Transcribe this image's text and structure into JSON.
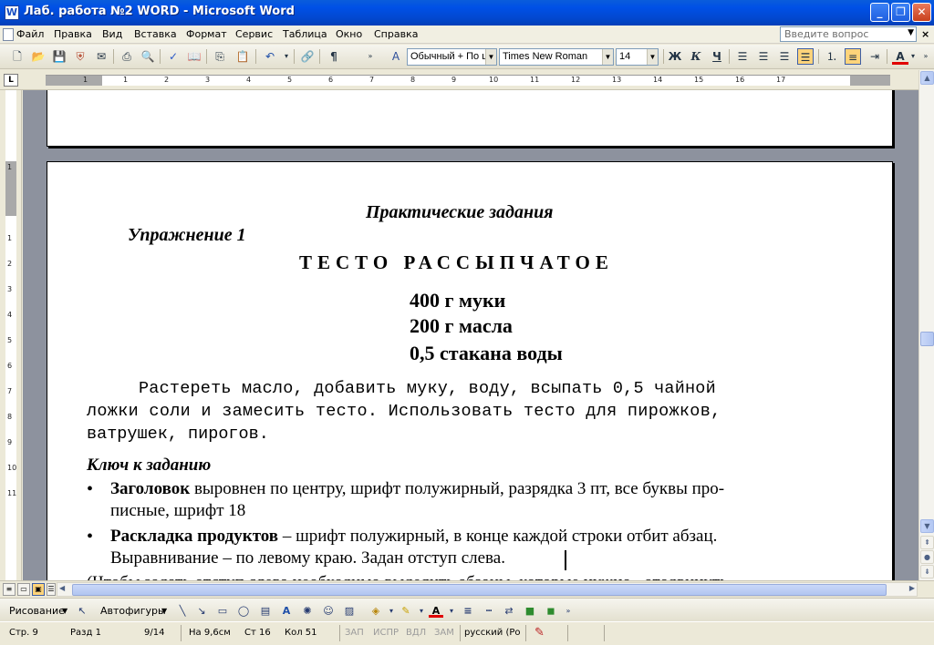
{
  "window": {
    "title": "Лаб. работа №2 WORD - Microsoft Word",
    "app_icon": "W",
    "minimize": "_",
    "maximize": "❐",
    "close": "✕"
  },
  "menu": {
    "items": [
      "Файл",
      "Правка",
      "Вид",
      "Вставка",
      "Формат",
      "Сервис",
      "Таблица",
      "Окно",
      "Справка"
    ],
    "help_placeholder": "Введите вопрос",
    "doc_close": "×"
  },
  "toolbar": {
    "style_value": "Обычный + По ц",
    "font_value": "Times New Roman",
    "size_value": "14",
    "bold_label": "Ж",
    "italic_label": "К",
    "underline_label": "Ч",
    "font_color_label": "A"
  },
  "ruler": {
    "h_numbers": [
      "1",
      "1",
      "2",
      "3",
      "4",
      "5",
      "6",
      "7",
      "8",
      "9",
      "10",
      "11",
      "12",
      "13",
      "14",
      "15",
      "16",
      "17"
    ],
    "v_numbers": [
      "1",
      "1",
      "2",
      "3",
      "4",
      "5",
      "6",
      "7",
      "8",
      "9",
      "10",
      "11"
    ]
  },
  "document": {
    "section_title": "Практические задания",
    "exercise": "Упражнение 1",
    "heading": "ТЕСТО РАССЫПЧАТОЕ",
    "ingredients": [
      "400 г муки",
      "200 г масла",
      "0,5 стакана воды"
    ],
    "recipe_lines": [
      "Растереть масло, добавить муку, воду, всыпать 0,5 чайной",
      "ложки соли и замесить тесто. Использовать тесто для пирожков,",
      "ватрушек, пирогов."
    ],
    "key_title": "Ключ к заданию",
    "bullet1_bold": "Заголовок",
    "bullet1_text": " выровнен по центру, шрифт полужирный, разрядка 3 пт, все буквы про-",
    "bullet1_cont": "писные, шрифт 18",
    "bullet2_bold": "Раскладка продуктов",
    "bullet2_text": " – шрифт полужирный, в конце каждой строки отбит абзац.",
    "bullet2_cont": "Выравнивание – по левому краю. Задан отступ слева.",
    "cut_line": "(Чтобы задать отступ слева необходимо выделить абзацы, которые нужно «отодвинуть»"
  },
  "drawing": {
    "draw_label": "Рисование",
    "autoshapes_label": "Автофигуры"
  },
  "status": {
    "page": "Стр. 9",
    "section": "Разд 1",
    "pages": "9/14",
    "at": "На 9,6см",
    "line": "Ст 16",
    "col": "Кол 51",
    "rec": "ЗАП",
    "trk": "ИСПР",
    "ext": "ВДЛ",
    "ovr": "ЗАМ",
    "lang": "русский (Ро"
  }
}
